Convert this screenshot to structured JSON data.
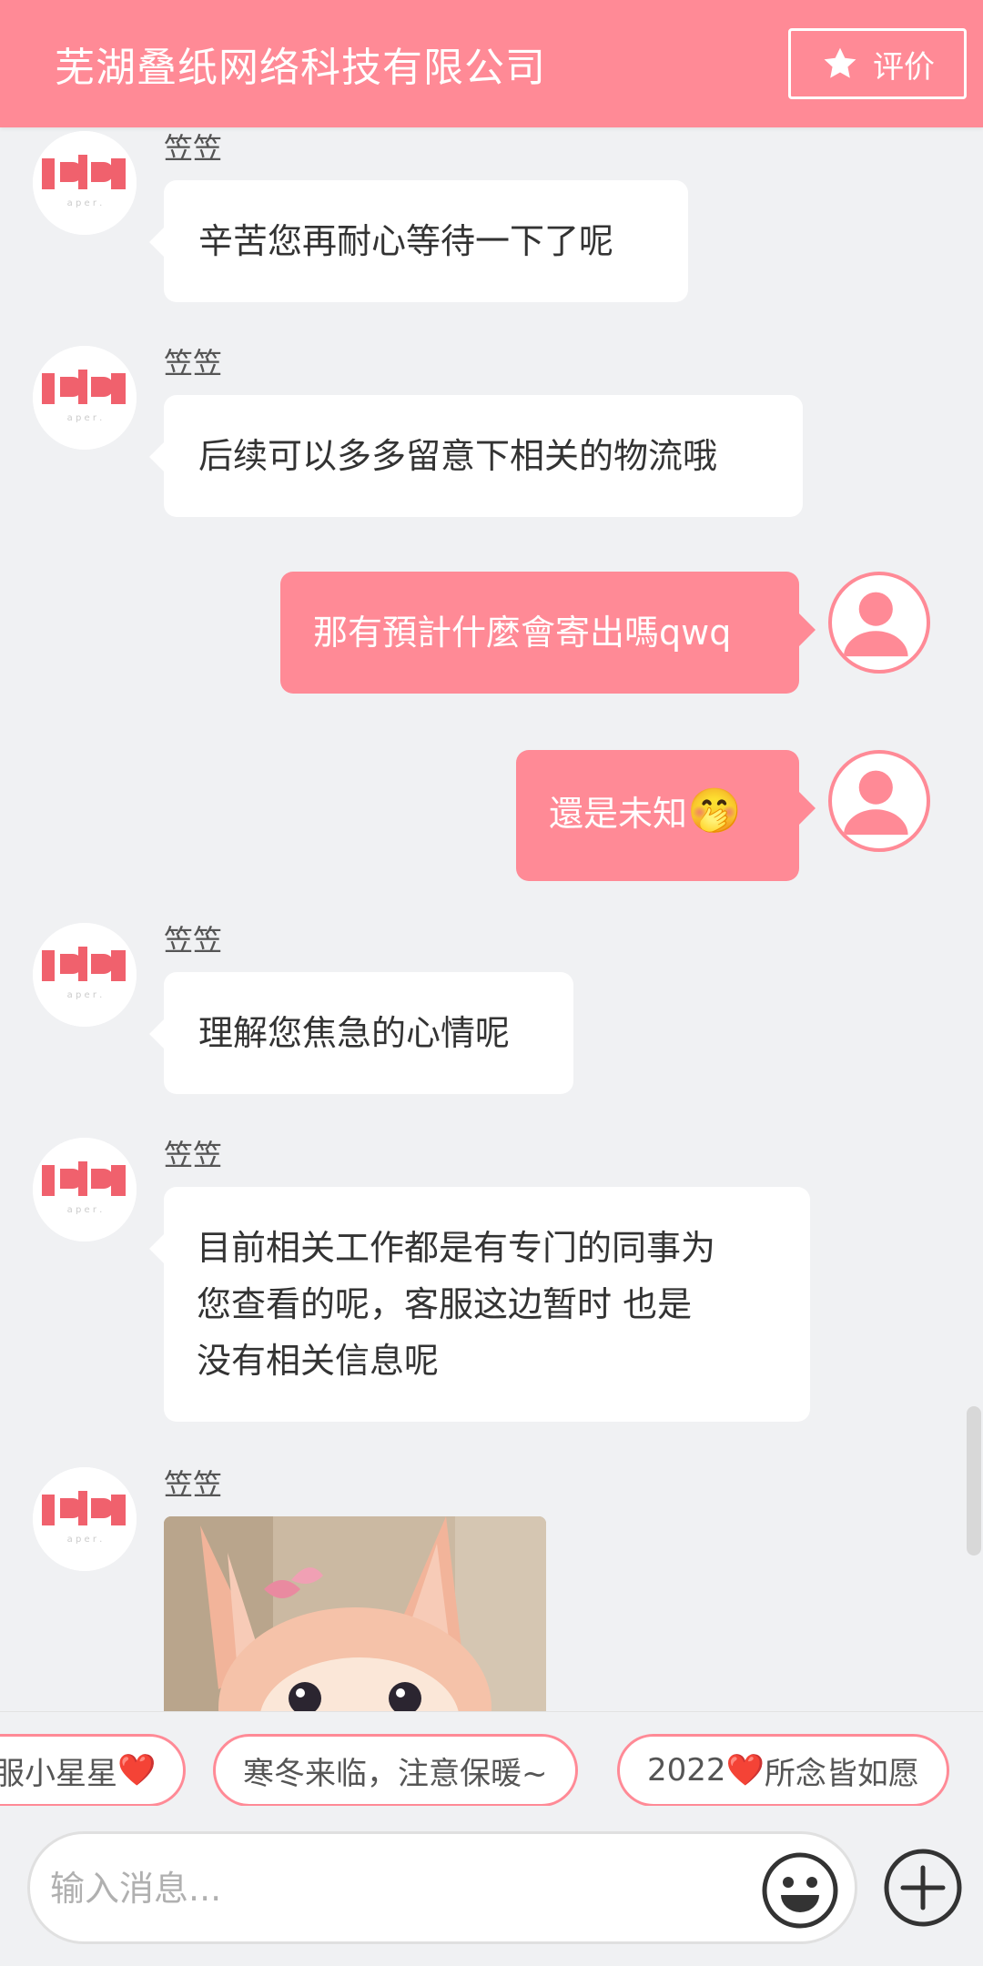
{
  "header": {
    "title": "芜湖叠纸网络科技有限公司",
    "rate_label": "评价"
  },
  "colors": {
    "accent": "#ff8a96",
    "header_bg": "#ff8a96",
    "chat_bg": "#f0f1f3",
    "bubble_in_bg": "#ffffff"
  },
  "messages": [
    {
      "direction": "in",
      "sender": "笠笠",
      "text": "辛苦您再耐心等待一下了呢"
    },
    {
      "direction": "in",
      "sender": "笠笠",
      "text": "后续可以多多留意下相关的物流哦"
    },
    {
      "direction": "out",
      "text": "那有預計什麼會寄出嗎qwq"
    },
    {
      "direction": "out",
      "text": "還是未知",
      "emoji": "🤭"
    },
    {
      "direction": "in",
      "sender": "笠笠",
      "text": "理解您焦急的心情呢"
    },
    {
      "direction": "in",
      "sender": "笠笠",
      "lines": [
        "目前相关工作都是有专门的同事为",
        "您查看的呢，客服这边暂时 也是",
        "没有相关信息呢"
      ]
    },
    {
      "direction": "in",
      "sender": "笠笠",
      "image": "plush-fox-photo"
    }
  ],
  "quick_replies": [
    {
      "text": "服小星星",
      "heart": "❤️"
    },
    {
      "text": "寒冬来临，注意保暖~"
    },
    {
      "prefix": "2022",
      "heart": "❤️",
      "text": "所念皆如愿"
    }
  ],
  "composer": {
    "placeholder": "输入消息...",
    "value": "",
    "emoji_icon": "smiley-face-icon",
    "plus_icon": "plus-circle-icon"
  }
}
